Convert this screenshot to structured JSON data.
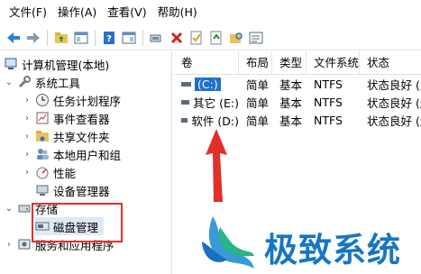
{
  "menu": {
    "file": "文件(F)",
    "action": "操作(A)",
    "view": "查看(V)",
    "help": "帮助(H)"
  },
  "toolbar": {
    "icons": [
      "back-icon",
      "forward-icon",
      "up-folder-icon",
      "show-tree-icon",
      "help-icon",
      "properties-icon",
      "connect-icon",
      "delete-icon",
      "check-icon",
      "export-icon",
      "find-icon",
      "console-icon"
    ]
  },
  "tree": {
    "root": "计算机管理(本地)",
    "system_tools": "系统工具",
    "task_scheduler": "任务计划程序",
    "event_viewer": "事件查看器",
    "shared_folders": "共享文件夹",
    "local_users": "本地用户和组",
    "performance": "性能",
    "device_manager": "设备管理器",
    "storage": "存储",
    "disk_management": "磁盘管理",
    "services": "服务和应用程序"
  },
  "list": {
    "columns": [
      "卷",
      "布局",
      "类型",
      "文件系统",
      "状态"
    ],
    "rows": [
      {
        "volume": "(C:)",
        "layout": "简单",
        "type": "基本",
        "fs": "NTFS",
        "status": "状态良好 (启"
      },
      {
        "volume": "其它 (E:)",
        "layout": "简单",
        "type": "基本",
        "fs": "NTFS",
        "status": "状态良好 (逻"
      },
      {
        "volume": "软件 (D:)",
        "layout": "简单",
        "type": "基本",
        "fs": "NTFS",
        "status": "状态良好 (逻"
      }
    ]
  },
  "watermark": {
    "text": "极致系统"
  },
  "colors": {
    "accent_red": "#e0302a",
    "watermark_blue": "#1676c4",
    "selection_blue": "#1f6fce"
  }
}
